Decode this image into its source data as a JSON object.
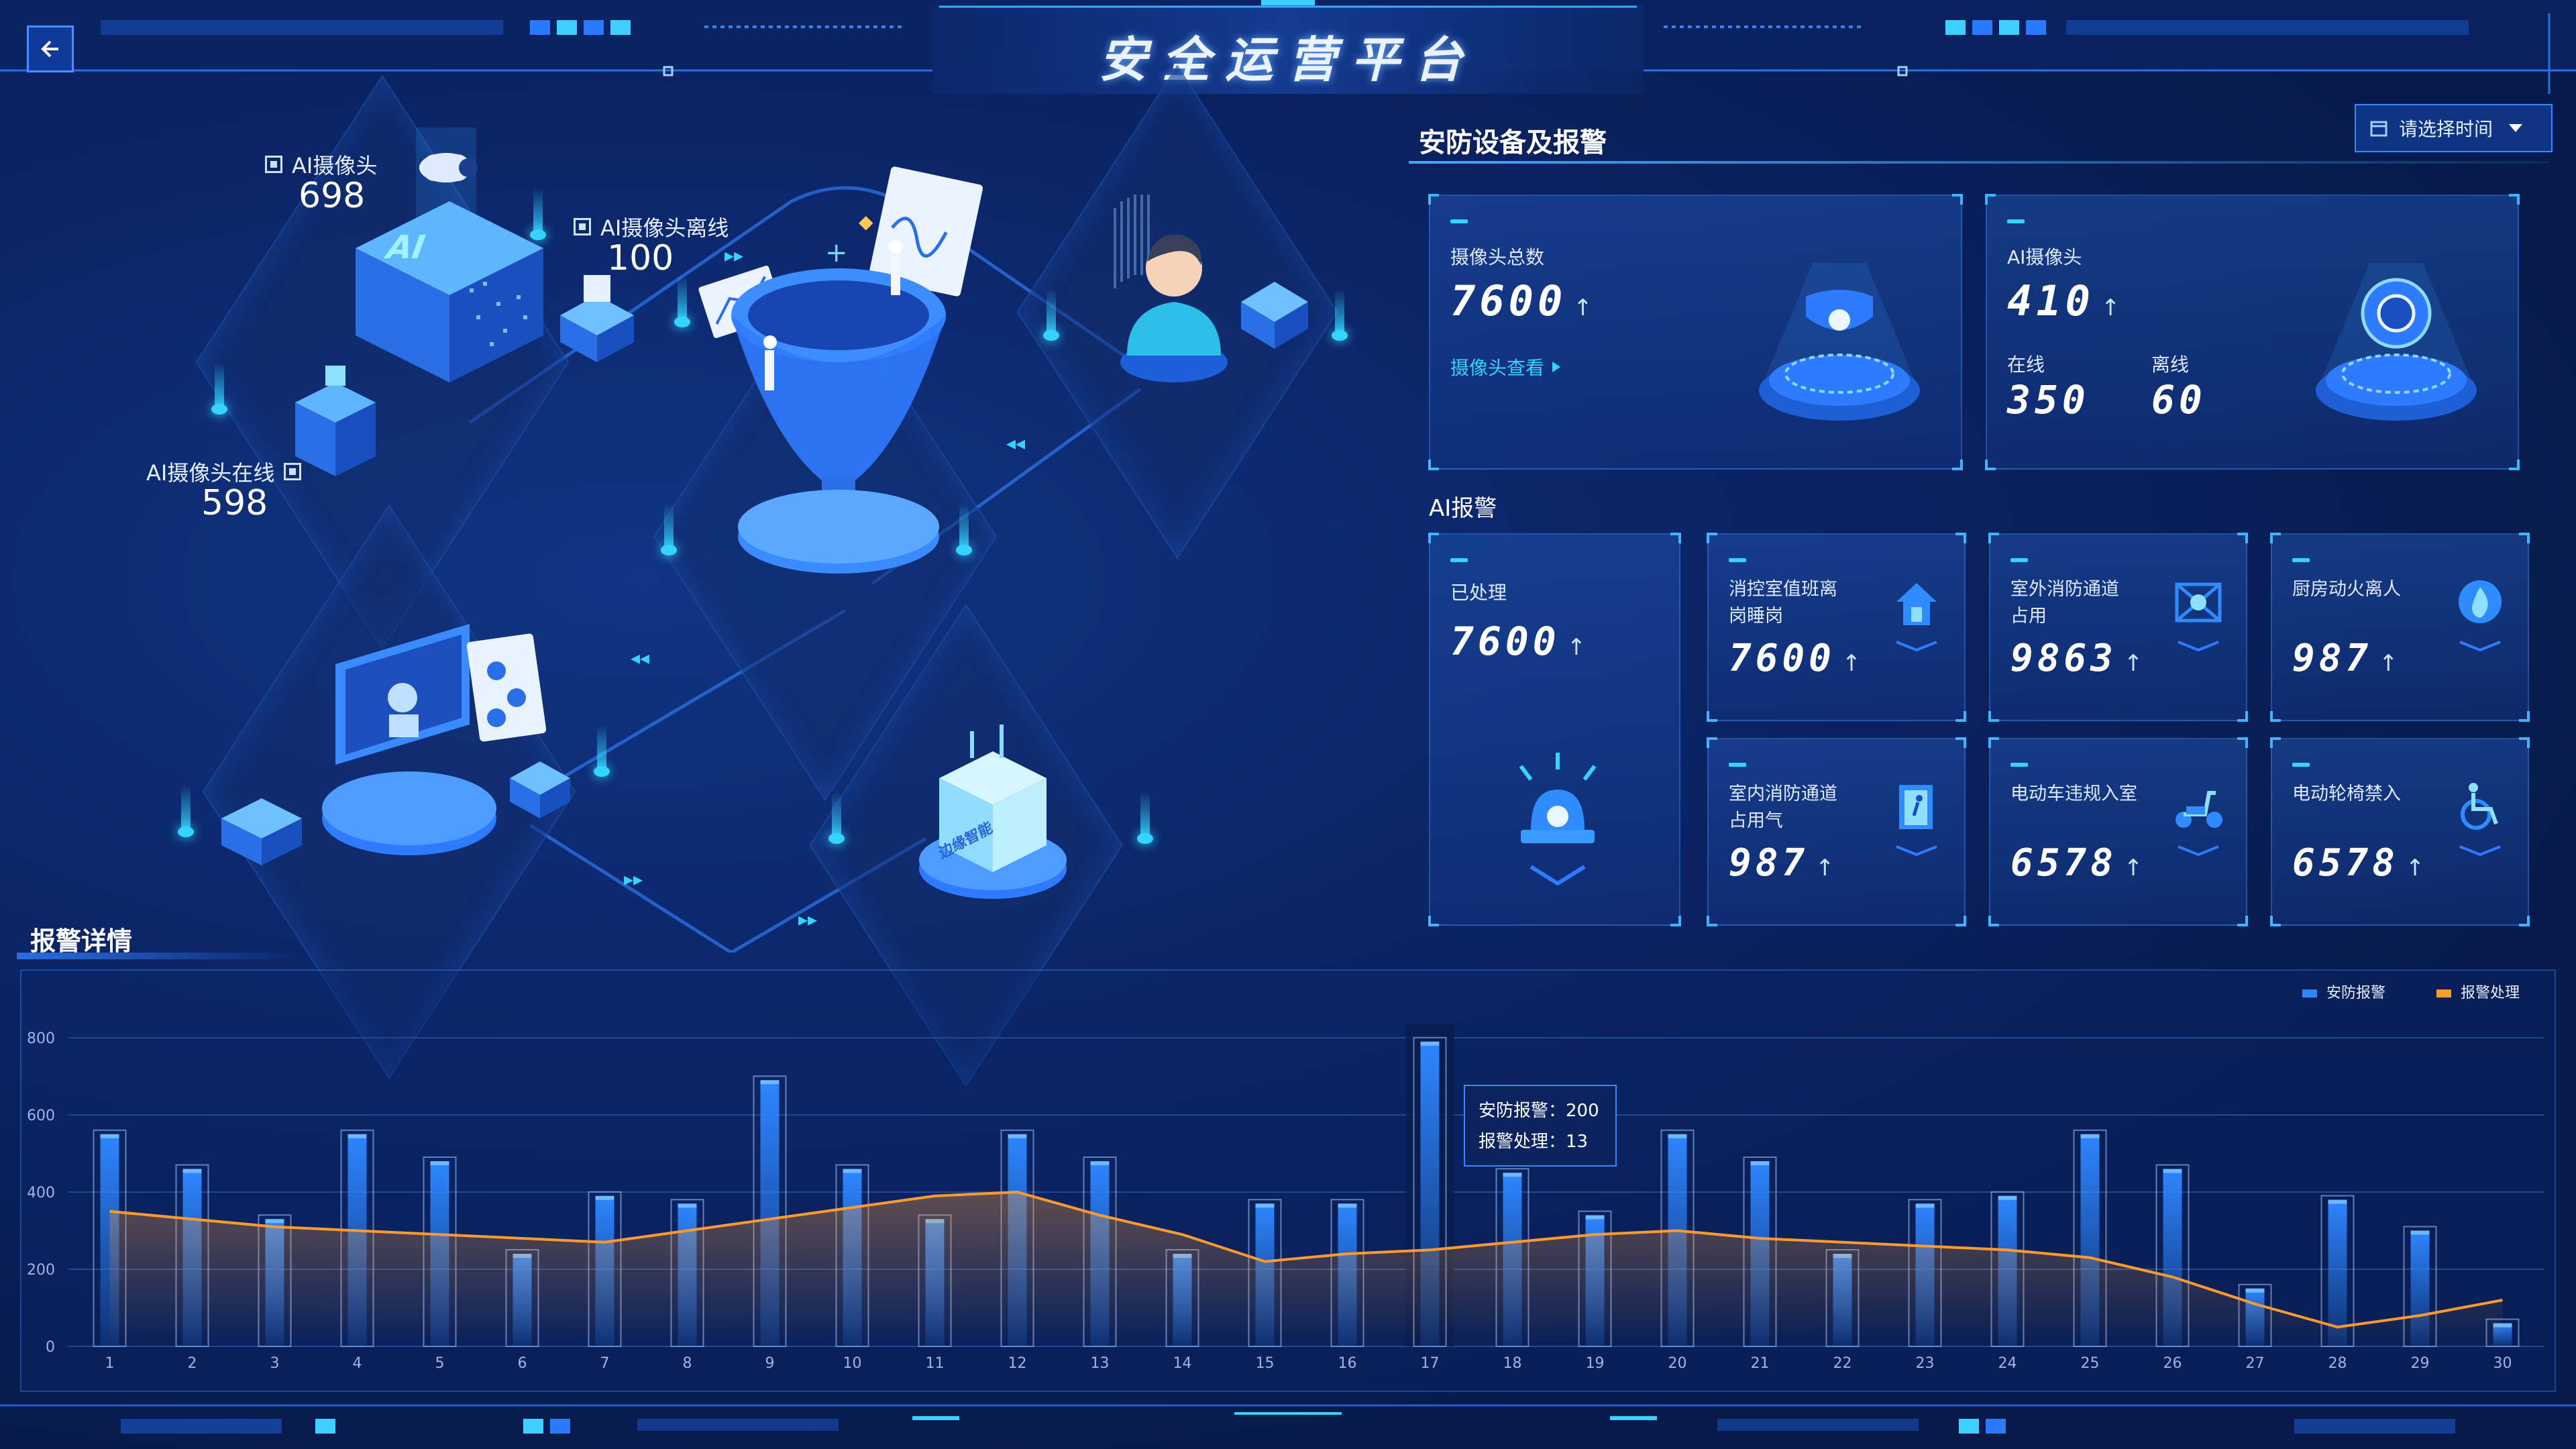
{
  "header": {
    "title": "安全运营平台"
  },
  "left_scene": {
    "ai_camera": {
      "label": "AI摄像头",
      "value": "698"
    },
    "ai_camera_offline": {
      "label": "AI摄像头离线",
      "value": "100"
    },
    "ai_camera_online": {
      "label": "AI摄像头在线",
      "value": "598"
    },
    "edge_box_text": "边缘智能"
  },
  "device_panel": {
    "title": "安防设备及报警",
    "time_select_placeholder": "请选择时间",
    "camera_total": {
      "label": "摄像头总数",
      "value": "7600",
      "link": "摄像头查看"
    },
    "ai_camera": {
      "label": "AI摄像头",
      "value": "410",
      "online_label": "在线",
      "online_value": "350",
      "offline_label": "离线",
      "offline_value": "60"
    },
    "ai_alarm_title": "AI报警",
    "processed": {
      "label": "已处理",
      "value": "7600"
    },
    "alarms": [
      {
        "label_line1": "消控室值班离",
        "label_line2": "岗睡岗",
        "value": "7600",
        "icon": "house-alarm-icon"
      },
      {
        "label_line1": "室外消防通道",
        "label_line2": "占用",
        "value": "9863",
        "icon": "blocked-passage-icon"
      },
      {
        "label_line1": "厨房动火离人",
        "label_line2": "",
        "value": "987",
        "icon": "fire-icon"
      },
      {
        "label_line1": "室内消防通道",
        "label_line2": "占用气",
        "value": "987",
        "icon": "door-exit-icon"
      },
      {
        "label_line1": "电动车违规入室",
        "label_line2": "",
        "value": "6578",
        "icon": "scooter-icon"
      },
      {
        "label_line1": "电动轮椅禁入",
        "label_line2": "",
        "value": "6578",
        "icon": "wheelchair-icon"
      }
    ]
  },
  "alarm_detail": {
    "title": "报警详情",
    "tooltip": {
      "line1": "安防报警：200",
      "line2": "报警处理：13"
    }
  },
  "chart_data": {
    "type": "bar",
    "categories": [
      "1",
      "2",
      "3",
      "4",
      "5",
      "6",
      "7",
      "8",
      "9",
      "10",
      "11",
      "12",
      "13",
      "14",
      "15",
      "16",
      "17",
      "18",
      "19",
      "20",
      "21",
      "22",
      "23",
      "24",
      "25",
      "26",
      "27",
      "28",
      "29",
      "30"
    ],
    "series": [
      {
        "name": "安防报警",
        "type": "bar",
        "color": "#2e86ff",
        "values": [
          550,
          460,
          330,
          550,
          480,
          240,
          390,
          370,
          690,
          460,
          330,
          550,
          480,
          240,
          370,
          370,
          790,
          450,
          340,
          550,
          480,
          240,
          370,
          390,
          550,
          460,
          150,
          380,
          300,
          60
        ]
      },
      {
        "name": "报警处理",
        "type": "line",
        "color": "#ff9a2e",
        "values": [
          350,
          330,
          310,
          300,
          290,
          280,
          270,
          300,
          330,
          360,
          390,
          400,
          340,
          290,
          220,
          240,
          250,
          270,
          290,
          300,
          280,
          270,
          260,
          250,
          230,
          180,
          110,
          50,
          80,
          120
        ]
      }
    ],
    "ylim": [
      0,
      800
    ],
    "yticks": [
      "0",
      "200",
      "400",
      "600",
      "800"
    ],
    "legend_position": "top-right",
    "grid": true,
    "highlight_index": 16
  }
}
